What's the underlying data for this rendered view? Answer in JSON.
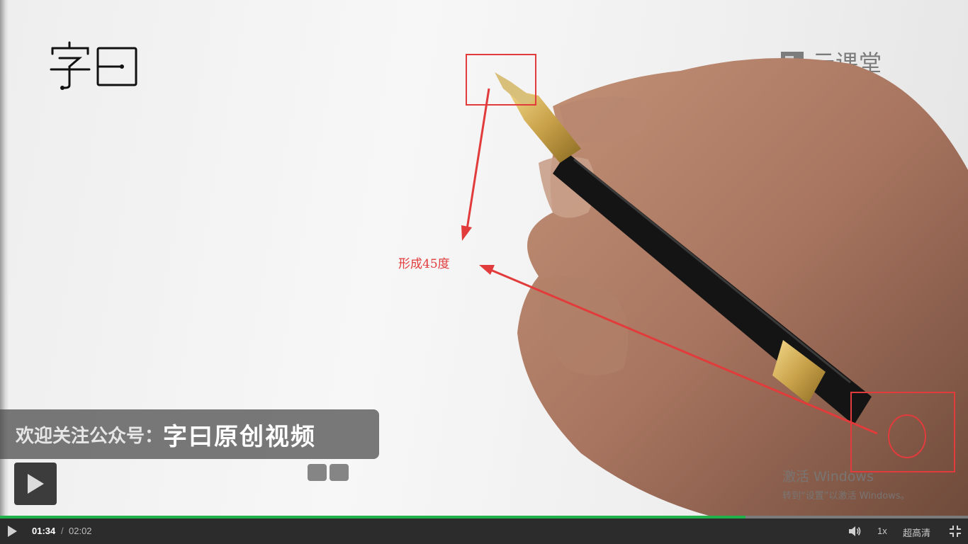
{
  "video": {
    "brand_logo_text": "字曰",
    "watermark_text": "云课堂",
    "annotation_label": "形成45度",
    "subtitle_prefix": "欢迎关注公众号：",
    "subtitle_title": "字曰原创视频"
  },
  "os_overlay": {
    "activation_title": "激活 Windows",
    "activation_sub": "转到“设置”以激活 Windows。"
  },
  "player": {
    "progress_fraction": 0.77,
    "progress_color": "#21b14b",
    "current_time": "01:34",
    "separator": "/",
    "total_time": "02:02",
    "speed_label": "1x",
    "quality_label": "超高清"
  },
  "icons": {
    "big_play": "play-icon",
    "control_play": "play-icon",
    "volume": "speaker-icon",
    "fullscreen": "exit-fullscreen-icon",
    "watermark": "cloud-classroom-logo-icon"
  },
  "colors": {
    "annotation_red": "#e23b3b",
    "control_bar_bg": "#2c2c2c"
  }
}
